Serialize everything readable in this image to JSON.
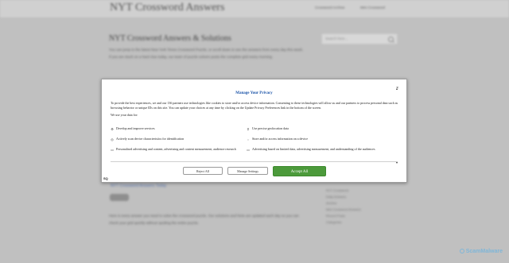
{
  "site": {
    "title": "NYT Crossword Answers",
    "nav": [
      "Crossword Archive",
      "Mini Crossword"
    ],
    "main_heading": "NYT Crossword Answers & Solutions",
    "intro": "You can jump to the latest New York Times Crossword Puzzle, or scroll down to see the answers from every day this week. If you are stuck on a hard clue today, our team of puzzle solvers posts the complete grid every morning.",
    "search_placeholder": "Search here...",
    "post_link": "NYT Crossword Answers Today",
    "body_text": "Here is every answer you need to solve the crossword puzzle. Our solutions and hints are updated each day so you can check your grid quickly without spoiling the entire puzzle.",
    "sidebar_links": [
      "NYT Crossword",
      "Daily Answers",
      "Archive",
      "Mini Crossword Answers",
      "Recent Posts",
      "Categories"
    ]
  },
  "dialog": {
    "title": "Manage Your Privacy",
    "close_label": "×",
    "description": "To provide the best experiences, we and our 136 partners use technologies like cookies to store and/or access device information. Consenting to these technologies will allow us and our partners to process personal data such as browsing behavior or unique IDs on this site. You can update your choices at any time by clicking on the Update Privacy Preferences link in the bottom of the screen.",
    "uses_label": "We use your data for:",
    "purposes": [
      {
        "icon": "person-icon",
        "glyph": "⚙",
        "label": "Develop and improve services"
      },
      {
        "icon": "location-icon",
        "glyph": "⚲",
        "label": "Use precise geolocation data"
      },
      {
        "icon": "scan-icon",
        "glyph": "◎",
        "label": "Actively scan device characteristics for identification"
      },
      {
        "icon": "device-icon",
        "glyph": "◌",
        "label": "Store and/or access information on a device"
      },
      {
        "icon": "ads-icon",
        "glyph": "▭",
        "label": "Personalised advertising and content, advertising and content measurement, audience research"
      },
      {
        "icon": "limited-ads-icon",
        "glyph": "▭",
        "label": "Advertising based on limited data, advertising measurement, and understanding of the audiences"
      }
    ],
    "buttons": {
      "reject": "Reject All",
      "manage": "Manage Settings",
      "accept": "Accept All"
    },
    "brand": "SQ",
    "accent_color": "#4c9a3b",
    "title_color": "#1a53a8"
  },
  "watermark": "ScamMalware"
}
